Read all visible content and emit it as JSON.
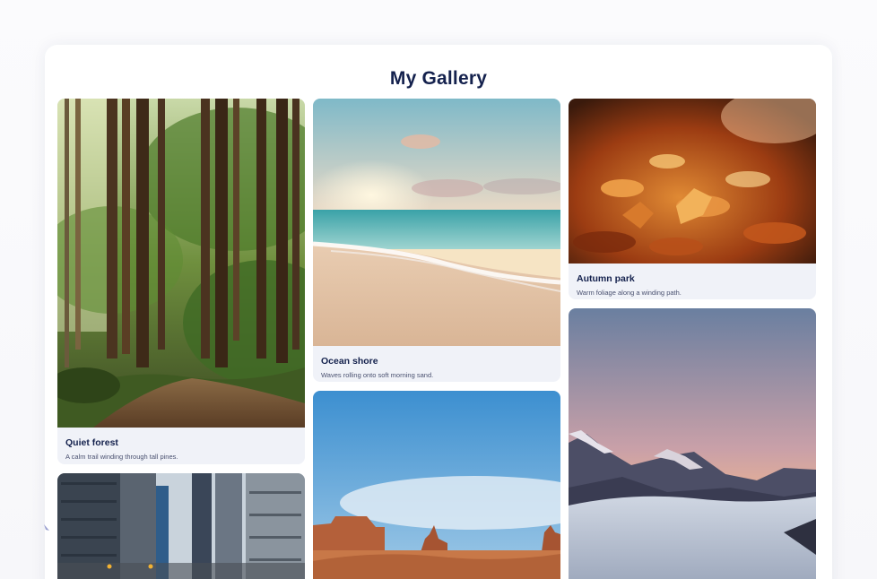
{
  "gallery": {
    "title": "My Gallery",
    "cards": [
      {
        "title": "Quiet forest",
        "description": "A calm trail winding through tall pines."
      },
      {
        "title": "Ocean shore",
        "description": "Waves rolling onto soft morning sand."
      },
      {
        "title": "Autumn park",
        "description": "Warm foliage along a winding path."
      },
      {
        "title": "",
        "description": ""
      },
      {
        "title": "",
        "description": ""
      },
      {
        "title": "",
        "description": ""
      }
    ]
  },
  "colors": {
    "heading": "#14214d",
    "card_background": "#f0f2f8"
  }
}
